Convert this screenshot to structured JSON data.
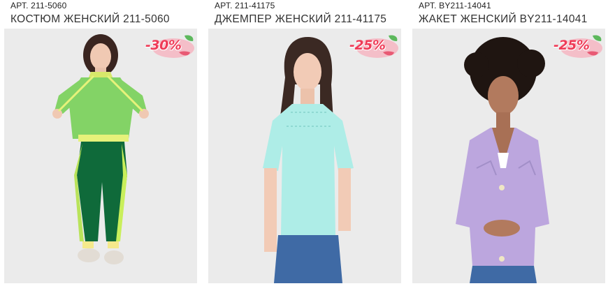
{
  "products": [
    {
      "sku": "АРТ. 211-5060",
      "title": "КОСТЮМ ЖЕНСКИЙ 211-5060",
      "discount": "-30%",
      "image": "woman-in-green-sweatshirt-and-track-pants-photo"
    },
    {
      "sku": "АРТ. 211-41175",
      "title": "ДЖЕМПЕР ЖЕНСКИЙ 211-41175",
      "discount": "-25%",
      "image": "woman-in-mint-knit-tshirt-photo"
    },
    {
      "sku": "АРТ. BY211-14041",
      "title": "ЖАКЕТ ЖЕНСКИЙ BY211-14041",
      "discount": "-25%",
      "image": "woman-in-lavender-knit-cardigan-photo"
    }
  ],
  "colors": {
    "photo_background": "#ebebeb",
    "discount_text": "#ef3b57",
    "badge_leaf": "#5cb85c"
  }
}
